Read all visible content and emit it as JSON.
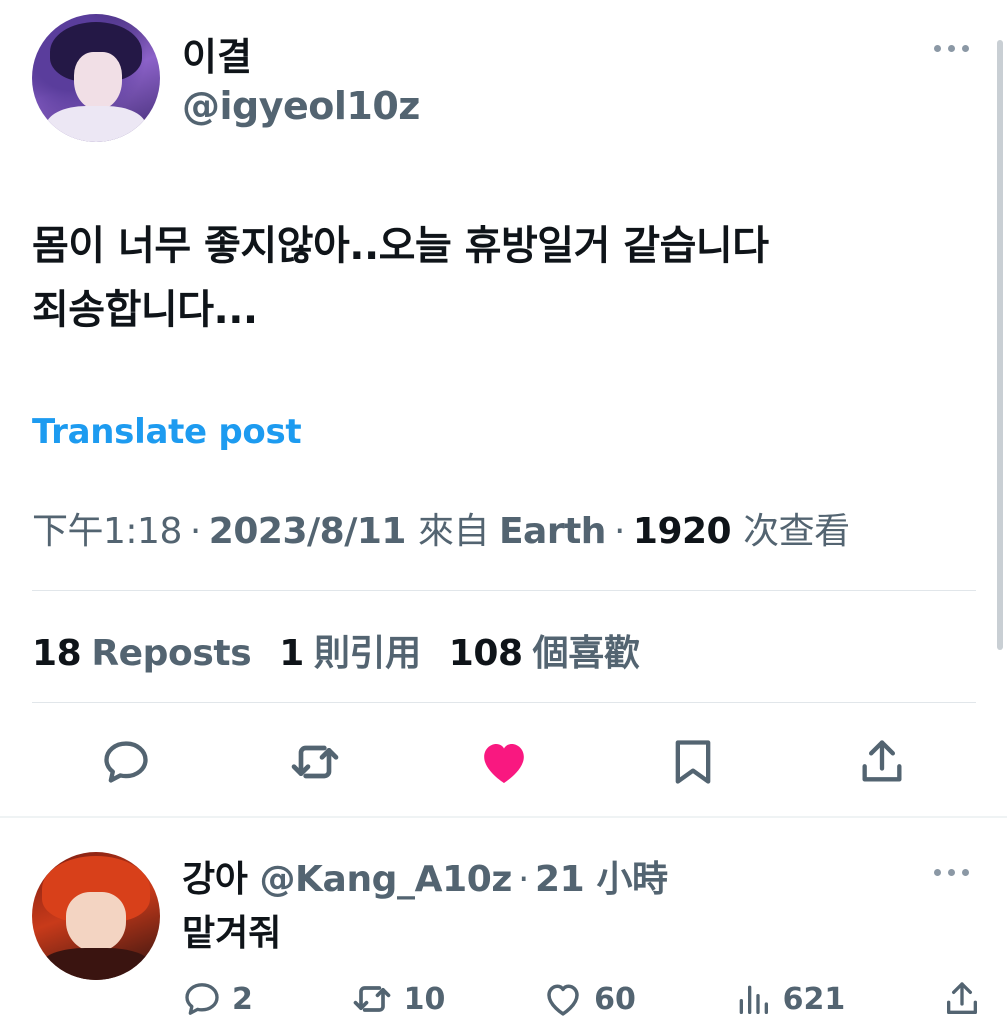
{
  "tweet": {
    "display_name": "이결",
    "handle": "@igyeol10z",
    "text_line1": "몸이 너무 좋지않아..오늘 휴방일거 같습니다",
    "text_line2": "죄송합니다...",
    "translate_label": "Translate post",
    "time": "下午1:18",
    "date": "2023/8/11",
    "source_prefix": "來自",
    "source": "Earth",
    "views_count": "1920",
    "views_label": "次查看",
    "separator": "·"
  },
  "stats": {
    "reposts_count": "18",
    "reposts_label": "Reposts",
    "quotes_count": "1",
    "quotes_label": "則引用",
    "likes_count": "108",
    "likes_label": "個喜歡"
  },
  "actions": {
    "icons": [
      "reply-icon",
      "repost-icon",
      "like-icon",
      "bookmark-icon",
      "share-icon"
    ],
    "liked": true,
    "like_color": "#f91880"
  },
  "reply": {
    "display_name": "강아",
    "handle": "@Kang_A10z",
    "separator": "·",
    "time": "21 小時",
    "text": "맡겨줘",
    "replies": "2",
    "reposts": "10",
    "likes": "60",
    "views": "621"
  },
  "colors": {
    "text": "#0f1419",
    "muted": "#536471",
    "link": "#1d9bf0",
    "divider": "#e1e6ea"
  }
}
